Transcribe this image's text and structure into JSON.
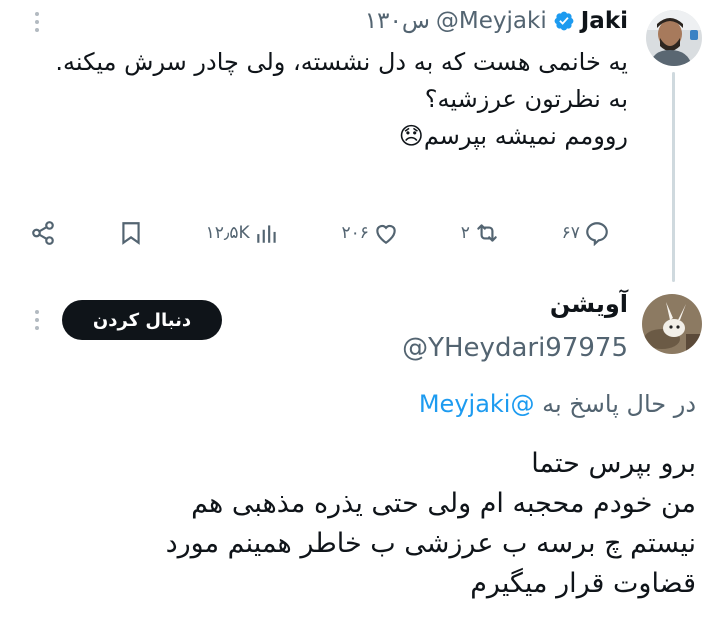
{
  "tweet": {
    "author_name": "Jaki",
    "author_handle": "@Meyjaki",
    "time": "۱۳۰س",
    "text": "یه خانمی هست که به دل نشسته، ولی چادر سرش میکنه.\nبه نظرتون عرزشیه؟\nروومم نمیشه بپرسم😞",
    "actions": {
      "replies": "۶۷",
      "retweets": "۲",
      "likes": "۲۰۶",
      "views": "۱۲٫۵K"
    }
  },
  "reply": {
    "author_name": "آویشن",
    "author_handle": "@YHeydari97975",
    "follow_label": "دنبال کردن",
    "replying_prefix": "در حال پاسخ به",
    "replying_to": "@Meyjaki",
    "text": "برو بپرس حتما\nمن خودم محجبه ام ولی حتی یذره مذهبی هم\nنیستم چ برسه ب عرزشی ب خاطر همینم مورد\nقضاوت قرار میگیرم"
  },
  "colors": {
    "accent": "#1d9bf0",
    "text": "#0f1419",
    "secondary": "#536471"
  }
}
